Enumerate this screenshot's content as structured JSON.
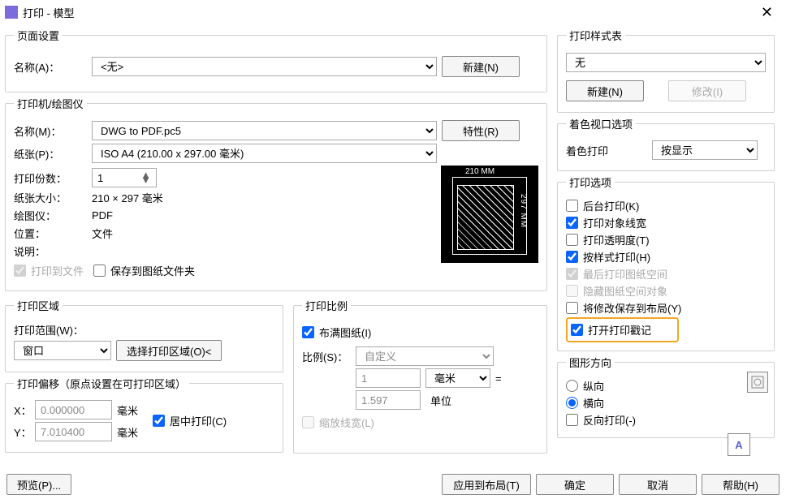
{
  "window": {
    "title": "打印 - 模型",
    "close_icon": "✕"
  },
  "pageSetup": {
    "legend": "页面设置",
    "name_label": "名称(A)：",
    "name_value": "<无>",
    "new_btn": "新建(N)"
  },
  "printer": {
    "legend": "打印机/绘图仪",
    "name_label": "名称(M)：",
    "name_value": "DWG to PDF.pc5",
    "props_btn": "特性(R)",
    "paper_label": "纸张(P)：",
    "paper_value": "ISO A4 (210.00 x 297.00 毫米)",
    "copies_label": "打印份数：",
    "copies_value": "1",
    "size_label": "纸张大小：",
    "size_value": "210 × 297  毫米",
    "plotter_label": "绘图仪：",
    "plotter_value": "PDF",
    "loc_label": "位置：",
    "loc_value": "文件",
    "desc_label": "说明：",
    "print_to_file": "打印到文件",
    "save_to_folder": "保存到图纸文件夹",
    "preview_top": "210 MM",
    "preview_right": "297 MM"
  },
  "plotArea": {
    "legend": "打印区域",
    "range_label": "打印范围(W)：",
    "range_value": "窗口",
    "select_btn": "选择打印区域(O)<"
  },
  "offset": {
    "legend": "打印偏移（原点设置在可打印区域）",
    "x_label": "X：",
    "x_value": "0.000000",
    "x_unit": "毫米",
    "y_label": "Y：",
    "y_value": "7.010400",
    "y_unit": "毫米",
    "center": "居中打印(C)"
  },
  "scale": {
    "legend": "打印比例",
    "fit_cb": "布满图纸(I)",
    "scale_label": "比例(S)：",
    "scale_value": "自定义",
    "unit1_value": "1",
    "unit1_sel": "毫米",
    "eq": "=",
    "unit2_value": "1.597",
    "unit2_label": "单位",
    "scale_lw": "缩放线宽(L)"
  },
  "styleTable": {
    "legend": "打印样式表",
    "value": "无",
    "new_btn": "新建(N)",
    "modify_btn": "修改(I)"
  },
  "shaded": {
    "legend": "着色视口选项",
    "label": "着色打印",
    "value": "按显示"
  },
  "options": {
    "legend": "打印选项",
    "items": [
      {
        "label": "后台打印(K)",
        "checked": false,
        "disabled": false
      },
      {
        "label": "打印对象线宽",
        "checked": true,
        "disabled": false
      },
      {
        "label": "打印透明度(T)",
        "checked": false,
        "disabled": false
      },
      {
        "label": "按样式打印(H)",
        "checked": true,
        "disabled": false
      },
      {
        "label": "最后打印图纸空间",
        "checked": true,
        "disabled": true
      },
      {
        "label": "隐藏图纸空间对象",
        "checked": false,
        "disabled": true
      },
      {
        "label": "将修改保存到布局(Y)",
        "checked": false,
        "disabled": false
      },
      {
        "label": "打开打印戳记",
        "checked": true,
        "disabled": false,
        "highlight": true
      }
    ]
  },
  "orientation": {
    "legend": "图形方向",
    "portrait": "纵向",
    "landscape": "横向",
    "reverse": "反向打印(-)",
    "selected": "landscape"
  },
  "footer": {
    "preview": "预览(P)...",
    "apply": "应用到布局(T)",
    "ok": "确定",
    "cancel": "取消",
    "help": "帮助(H)"
  }
}
